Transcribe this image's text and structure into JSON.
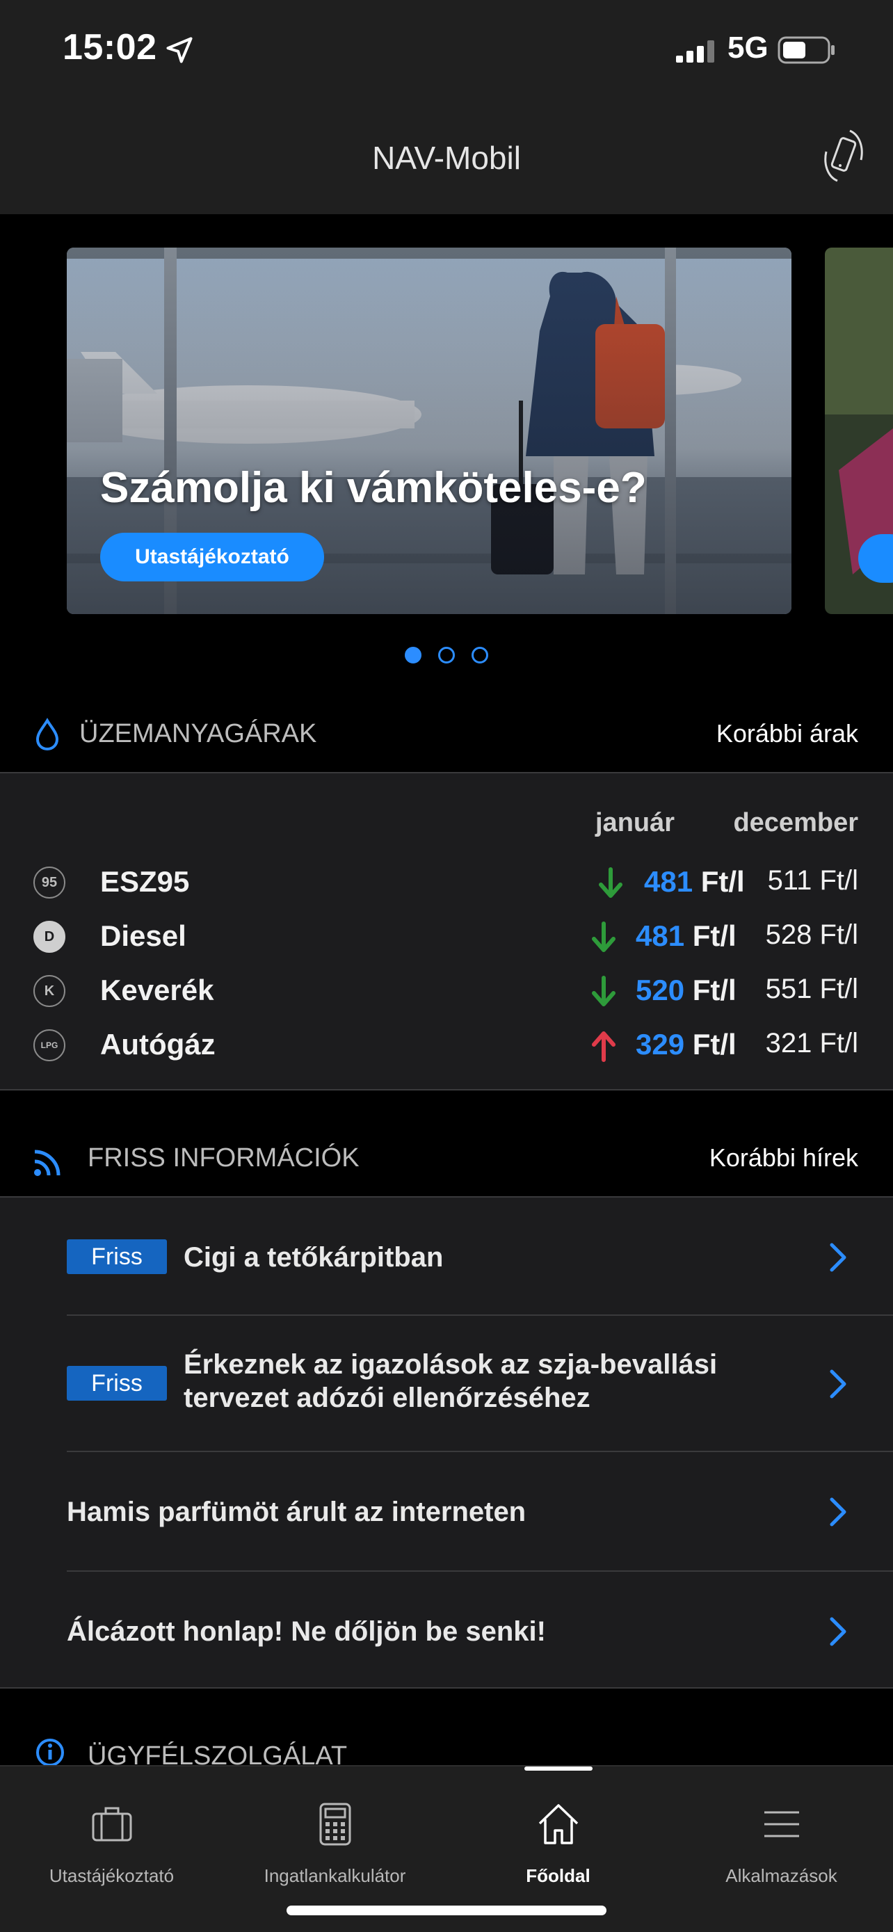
{
  "status_bar": {
    "time": "15:02",
    "network": "5G"
  },
  "header": {
    "title": "NAV-Mobil"
  },
  "hero": {
    "title": "Számolja ki vámköteles-e?",
    "button_label": "Utastájékoztató",
    "pages": 3,
    "active_page": 1
  },
  "fuel": {
    "section_title": "ÜZEMANYAGÁRAK",
    "link": "Korábbi árak",
    "col_current": "január",
    "col_previous": "december",
    "rows": [
      {
        "badge": "95",
        "name": "ESZ95",
        "trend": "down",
        "current": "481",
        "current_unit": "Ft/l",
        "previous": "511 Ft/l"
      },
      {
        "badge": "D",
        "name": "Diesel",
        "trend": "down",
        "current": "481",
        "current_unit": "Ft/l",
        "previous": "528 Ft/l"
      },
      {
        "badge": "K",
        "name": "Keverék",
        "trend": "down",
        "current": "520",
        "current_unit": "Ft/l",
        "previous": "551 Ft/l"
      },
      {
        "badge": "LPG",
        "name": "Autógáz",
        "trend": "up",
        "current": "329",
        "current_unit": "Ft/l",
        "previous": "321 Ft/l"
      }
    ]
  },
  "news": {
    "section_title": "FRISS INFORMÁCIÓK",
    "link": "Korábbi hírek",
    "items": [
      {
        "tag": "Friss",
        "title": "Cigi a tetőkárpitban"
      },
      {
        "tag": "Friss",
        "title_line1": "Érkeznek az igazolások az szja-bevallási",
        "title_line2": "tervezet adózói ellenőrzéséhez"
      },
      {
        "title": "Hamis parfümöt árult az interneten"
      },
      {
        "title": "Álcázott honlap! Ne dőljön be senki!"
      }
    ]
  },
  "next_section": {
    "title": "ÜGYFÉLSZOLGÁLAT"
  },
  "tabbar": {
    "tabs": [
      {
        "label": "Utastájékoztató",
        "icon": "suitcase-icon"
      },
      {
        "label": "Ingatlankalkulátor",
        "icon": "calculator-icon"
      },
      {
        "label": "Főoldal",
        "icon": "home-icon",
        "active": true
      },
      {
        "label": "Alkalmazások",
        "icon": "menu-icon"
      }
    ]
  },
  "colors": {
    "accent": "#2c8dff",
    "down_arrow": "#2e9b3a",
    "up_arrow": "#e03b4a",
    "badge_friss": "#1565c0"
  }
}
